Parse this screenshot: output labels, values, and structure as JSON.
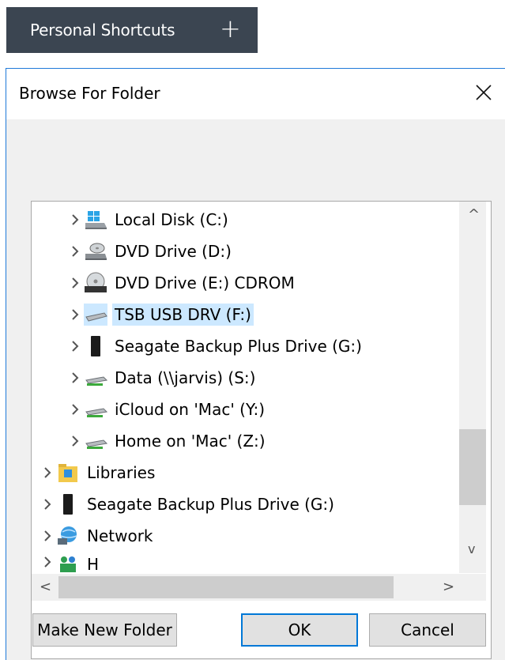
{
  "shortcuts": {
    "label": "Personal Shortcuts",
    "plus": "+"
  },
  "dialog": {
    "title": "Browse For Folder",
    "close": "✕",
    "tree": [
      {
        "label": "Local Disk (C:)",
        "icon": "local-disk-icon"
      },
      {
        "label": "DVD Drive (D:)",
        "icon": "dvd-drive-icon"
      },
      {
        "label": "DVD Drive (E:) CDROM",
        "icon": "dvd-rom-icon"
      },
      {
        "label": "TSB USB DRV (F:)",
        "icon": "usb-drive-icon",
        "selected": true
      },
      {
        "label": "Seagate Backup Plus Drive (G:)",
        "icon": "external-drive-icon"
      },
      {
        "label": "Data (\\\\jarvis) (S:)",
        "icon": "network-drive-icon"
      },
      {
        "label": "iCloud on 'Mac' (Y:)",
        "icon": "network-drive-icon"
      },
      {
        "label": "Home on 'Mac' (Z:)",
        "icon": "network-drive-icon"
      },
      {
        "label": "Libraries",
        "icon": "libraries-icon"
      },
      {
        "label": "Seagate Backup Plus Drive (G:)",
        "icon": "external-drive-icon"
      },
      {
        "label": "Network",
        "icon": "network-icon"
      },
      {
        "label": "H",
        "icon": "homegroup-icon"
      }
    ],
    "scroll": {
      "up": "^",
      "down": "v",
      "left": "<",
      "right": ">"
    },
    "buttons": {
      "make_new_folder": "Make New Folder",
      "ok": "OK",
      "cancel": "Cancel"
    }
  }
}
